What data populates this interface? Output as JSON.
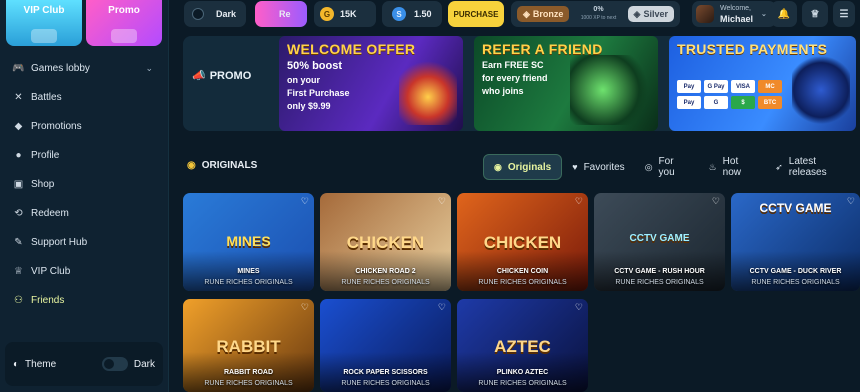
{
  "sidebar": {
    "tiles": [
      {
        "label": "VIP Club"
      },
      {
        "label": "Promo"
      }
    ],
    "items": [
      {
        "label": "Games lobby",
        "icon": "gamepad-icon"
      },
      {
        "label": "Battles",
        "icon": "swords-icon"
      },
      {
        "label": "Promotions",
        "icon": "tag-icon"
      },
      {
        "label": "Profile",
        "icon": "user-icon"
      },
      {
        "label": "Shop",
        "icon": "shop-icon"
      },
      {
        "label": "Redeem",
        "icon": "redeem-icon"
      },
      {
        "label": "Support Hub",
        "icon": "support-icon"
      },
      {
        "label": "VIP Club",
        "icon": "crown-icon"
      },
      {
        "label": "Friends",
        "icon": "friends-icon",
        "active": true
      }
    ],
    "theme": {
      "label": "Theme",
      "value": "Dark"
    }
  },
  "topbar": {
    "mode_label": "Dark",
    "promo_tab": "Re",
    "gold_balance": "15K",
    "sc_balance": "1.50",
    "purchase_label": "PURCHASE",
    "rank": {
      "current": "Bronze",
      "progress": "0%",
      "progress_note": "1000 XP to next",
      "next": "Silver"
    },
    "user": {
      "greeting": "Welcome,",
      "name": "Michael"
    }
  },
  "promo": {
    "label": "PROMO",
    "banners": [
      {
        "title": "WELCOME OFFER",
        "line1": "50% boost",
        "line2": "on your",
        "line3": "First Purchase",
        "line4": "only $9.99"
      },
      {
        "title": "REFER A FRIEND",
        "line1": "Earn FREE SC",
        "line2": "for every friend",
        "line3": "who joins"
      },
      {
        "title": "TRUSTED PAYMENTS",
        "methods": [
          "Pay",
          "G Pay",
          "VISA",
          "MC",
          "Pay",
          "G",
          "$",
          "BTC"
        ]
      }
    ]
  },
  "originals": {
    "title": "ORIGINALS",
    "tabs": [
      {
        "label": "Originals",
        "icon": "originals-icon",
        "active": true
      },
      {
        "label": "Favorites",
        "icon": "heart-icon"
      },
      {
        "label": "For you",
        "icon": "eye-icon"
      },
      {
        "label": "Hot now",
        "icon": "flame-icon"
      },
      {
        "label": "Latest releases",
        "icon": "rocket-icon"
      }
    ]
  },
  "games": [
    {
      "name": "MINES",
      "provider": "RUNE RICHES ORIGINALS",
      "art": "MINES"
    },
    {
      "name": "CHICKEN ROAD 2",
      "provider": "RUNE RICHES ORIGINALS",
      "art": "CHICKEN"
    },
    {
      "name": "CHICKEN COIN",
      "provider": "RUNE RICHES ORIGINALS",
      "art": "CHICKEN"
    },
    {
      "name": "CCTV GAME - RUSH HOUR",
      "provider": "RUNE RICHES ORIGINALS",
      "art": "CCTV GAME"
    },
    {
      "name": "CCTV GAME - DUCK RIVER",
      "provider": "RUNE RICHES ORIGINALS",
      "art": "CCTV GAME"
    },
    {
      "name": "RABBIT ROAD",
      "provider": "RUNE RICHES ORIGINALS",
      "art": "RABBIT"
    },
    {
      "name": "ROCK PAPER SCISSORS",
      "provider": "RUNE RICHES ORIGINALS",
      "art": ""
    },
    {
      "name": "PLINKO AZTEC",
      "provider": "RUNE RICHES ORIGINALS",
      "art": "AZTEC"
    }
  ]
}
